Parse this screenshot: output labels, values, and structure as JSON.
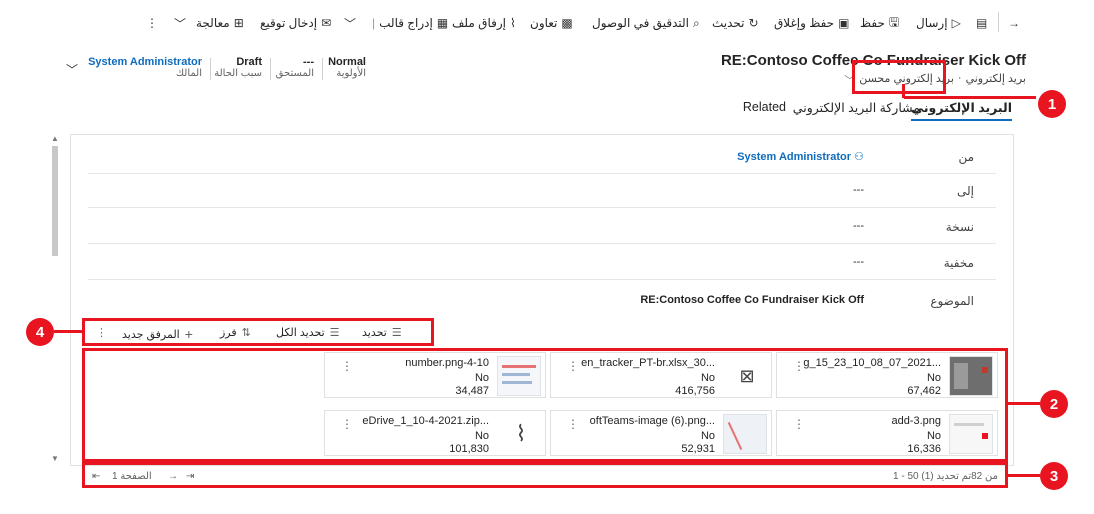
{
  "toolbar": {
    "back_icon": "arrow-left-icon",
    "send": "إرسال",
    "save": "حفظ",
    "save_close": "حفظ وإغلاق",
    "refresh": "تحديث",
    "accessibility": "التدقيق في الوصول",
    "collaborate": "تعاون",
    "attach_file": "إرفاق ملف",
    "insert_template": "إدراج قالب",
    "insert_signature": "إدخال توقيع",
    "process": "معالجة"
  },
  "header": {
    "title": "RE:Contoso Coffee Co Fundraiser Kick Off",
    "entity": "بريد إلكتروني",
    "form_name": "بريد إلكتروني محسن",
    "priority_value": "Normal",
    "priority_label": "الأولوية",
    "due_value": "---",
    "due_label": "المستحق",
    "status_value": "Draft",
    "status_label": "سبب الحالة",
    "owner_value": "System Administrator",
    "owner_label": "المالك"
  },
  "tabs": [
    "البريد الإلكتروني",
    "مشاركة البريد الإلكتروني",
    "Related"
  ],
  "form": {
    "from_label": "من",
    "from_value": "System Administrator",
    "to_label": "إلى",
    "to_value": "---",
    "cc_label": "نسخة",
    "cc_value": "---",
    "bcc_label": "مخفية",
    "bcc_value": "---",
    "subject_label": "الموضوع",
    "subject_value": "RE:Contoso Coffee Co Fundraiser Kick Off"
  },
  "attachments_bar": {
    "select": "تحديد",
    "select_all": "تحديد الكل",
    "sort": "فرز",
    "new_attachment": "المرفق جديد"
  },
  "attachments": [
    {
      "name": "g_15_23_10_08_07_2021...",
      "flag": "No",
      "size": "67,462"
    },
    {
      "name": "en_tracker_PT-br.xlsx_30...",
      "flag": "No",
      "size": "416,756"
    },
    {
      "name": "number.png-4-10",
      "flag": "No",
      "size": "34,487"
    },
    {
      "name": "add-3.png",
      "flag": "No",
      "size": "16,336"
    },
    {
      "name": "oftTeams-image (6).png...",
      "flag": "No",
      "size": "52,931"
    },
    {
      "name": "eDrive_1_10-4-2021.zip...",
      "flag": "No",
      "size": "101,830"
    }
  ],
  "footer": {
    "range": "1 - 50 من 82تم تحديد (1)",
    "page": "الصفحة 1"
  },
  "callouts": [
    "1",
    "2",
    "3",
    "4"
  ],
  "colors": {
    "accent": "#0f6cbd",
    "callout_red": "#e8141f"
  }
}
